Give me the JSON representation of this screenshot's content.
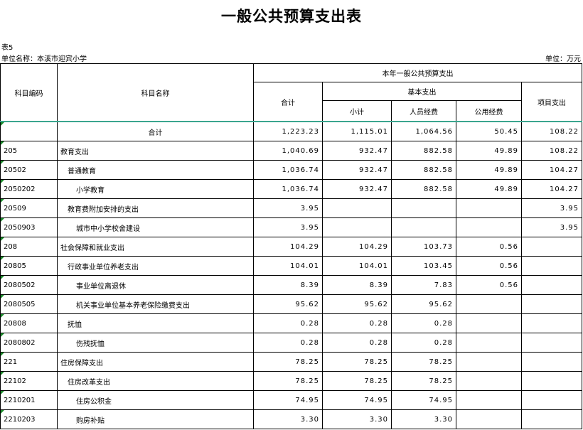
{
  "title": "一般公共预算支出表",
  "table_no": "表5",
  "unit_name": "单位名称：本溪市迎宾小学",
  "unit": "单位：万元",
  "headers": {
    "code": "科目编码",
    "name": "科目名称",
    "current_year": "本年一般公共预算支出",
    "total": "合计",
    "basic": "基本支出",
    "subtotal": "小计",
    "staff": "人员经费",
    "office": "公用经费",
    "project": "项目支出"
  },
  "rows": [
    {
      "code": "",
      "name": "合计",
      "level": "center",
      "total": "1,223.23",
      "subtotal": "1,115.01",
      "staff": "1,064.56",
      "office": "50.45",
      "project": "108.22"
    },
    {
      "code": "205",
      "name": "教育支出",
      "level": "lvl0",
      "total": "1,040.69",
      "subtotal": "932.47",
      "staff": "882.58",
      "office": "49.89",
      "project": "108.22"
    },
    {
      "code": "20502",
      "name": "普通教育",
      "level": "lvl1",
      "total": "1,036.74",
      "subtotal": "932.47",
      "staff": "882.58",
      "office": "49.89",
      "project": "104.27"
    },
    {
      "code": "2050202",
      "name": "小学教育",
      "level": "lvl2",
      "total": "1,036.74",
      "subtotal": "932.47",
      "staff": "882.58",
      "office": "49.89",
      "project": "104.27"
    },
    {
      "code": "20509",
      "name": "教育费附加安排的支出",
      "level": "lvl1",
      "total": "3.95",
      "subtotal": "",
      "staff": "",
      "office": "",
      "project": "3.95"
    },
    {
      "code": "2050903",
      "name": "城市中小学校舍建设",
      "level": "lvl2",
      "total": "3.95",
      "subtotal": "",
      "staff": "",
      "office": "",
      "project": "3.95"
    },
    {
      "code": "208",
      "name": "社会保障和就业支出",
      "level": "lvl0",
      "total": "104.29",
      "subtotal": "104.29",
      "staff": "103.73",
      "office": "0.56",
      "project": ""
    },
    {
      "code": "20805",
      "name": "行政事业单位养老支出",
      "level": "lvl1",
      "total": "104.01",
      "subtotal": "104.01",
      "staff": "103.45",
      "office": "0.56",
      "project": ""
    },
    {
      "code": "2080502",
      "name": "事业单位离退休",
      "level": "lvl2",
      "total": "8.39",
      "subtotal": "8.39",
      "staff": "7.83",
      "office": "0.56",
      "project": ""
    },
    {
      "code": "2080505",
      "name": "机关事业单位基本养老保险缴费支出",
      "level": "lvl2",
      "total": "95.62",
      "subtotal": "95.62",
      "staff": "95.62",
      "office": "",
      "project": ""
    },
    {
      "code": "20808",
      "name": "抚恤",
      "level": "lvl1",
      "total": "0.28",
      "subtotal": "0.28",
      "staff": "0.28",
      "office": "",
      "project": ""
    },
    {
      "code": "2080802",
      "name": "伤残抚恤",
      "level": "lvl2",
      "total": "0.28",
      "subtotal": "0.28",
      "staff": "0.28",
      "office": "",
      "project": ""
    },
    {
      "code": "221",
      "name": "住房保障支出",
      "level": "lvl0",
      "total": "78.25",
      "subtotal": "78.25",
      "staff": "78.25",
      "office": "",
      "project": ""
    },
    {
      "code": "22102",
      "name": "住房改革支出",
      "level": "lvl1",
      "total": "78.25",
      "subtotal": "78.25",
      "staff": "78.25",
      "office": "",
      "project": ""
    },
    {
      "code": "2210201",
      "name": "住房公积金",
      "level": "lvl2",
      "total": "74.95",
      "subtotal": "74.95",
      "staff": "74.95",
      "office": "",
      "project": ""
    },
    {
      "code": "2210203",
      "name": "购房补贴",
      "level": "lvl2",
      "total": "3.30",
      "subtotal": "3.30",
      "staff": "3.30",
      "office": "",
      "project": ""
    }
  ]
}
